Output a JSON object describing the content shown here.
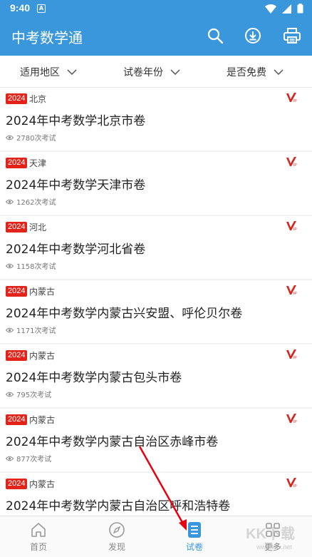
{
  "status": {
    "time": "9:40",
    "notif_icon": "A"
  },
  "appbar": {
    "title": "中考数学通",
    "icons": [
      "search-icon",
      "download-icon",
      "print-icon"
    ]
  },
  "filters": [
    {
      "label": "适用地区"
    },
    {
      "label": "试卷年份"
    },
    {
      "label": "是否免费"
    }
  ],
  "papers": [
    {
      "year": "2024",
      "region": "北京",
      "title": "2024年中考数学北京市卷",
      "views": "2780次考试"
    },
    {
      "year": "2024",
      "region": "天津",
      "title": "2024年中考数学天津市卷",
      "views": "1262次考试"
    },
    {
      "year": "2024",
      "region": "河北",
      "title": "2024年中考数学河北省卷",
      "views": "1158次考试"
    },
    {
      "year": "2024",
      "region": "内蒙古",
      "title": "2024年中考数学内蒙古兴安盟、呼伦贝尔卷",
      "views": "1171次考试"
    },
    {
      "year": "2024",
      "region": "内蒙古",
      "title": "2024年中考数学内蒙古包头市卷",
      "views": "795次考试"
    },
    {
      "year": "2024",
      "region": "内蒙古",
      "title": "2024年中考数学内蒙古自治区赤峰市卷",
      "views": "877次考试"
    },
    {
      "year": "2024",
      "region": "内蒙古",
      "title": "2024年中考数学内蒙古自治区呼和浩特卷",
      "views": ""
    }
  ],
  "nav": [
    {
      "label": "首页",
      "icon": "home-icon"
    },
    {
      "label": "发现",
      "icon": "compass-icon"
    },
    {
      "label": "试卷",
      "icon": "paper-icon"
    },
    {
      "label": "更多",
      "icon": "grid-icon"
    }
  ],
  "watermark": {
    "text": "KK下载",
    "url": "www.kkx.net"
  },
  "colors": {
    "primary": "#3a97dc",
    "year_badge": "#e2231a",
    "vip": "#d7261e"
  }
}
